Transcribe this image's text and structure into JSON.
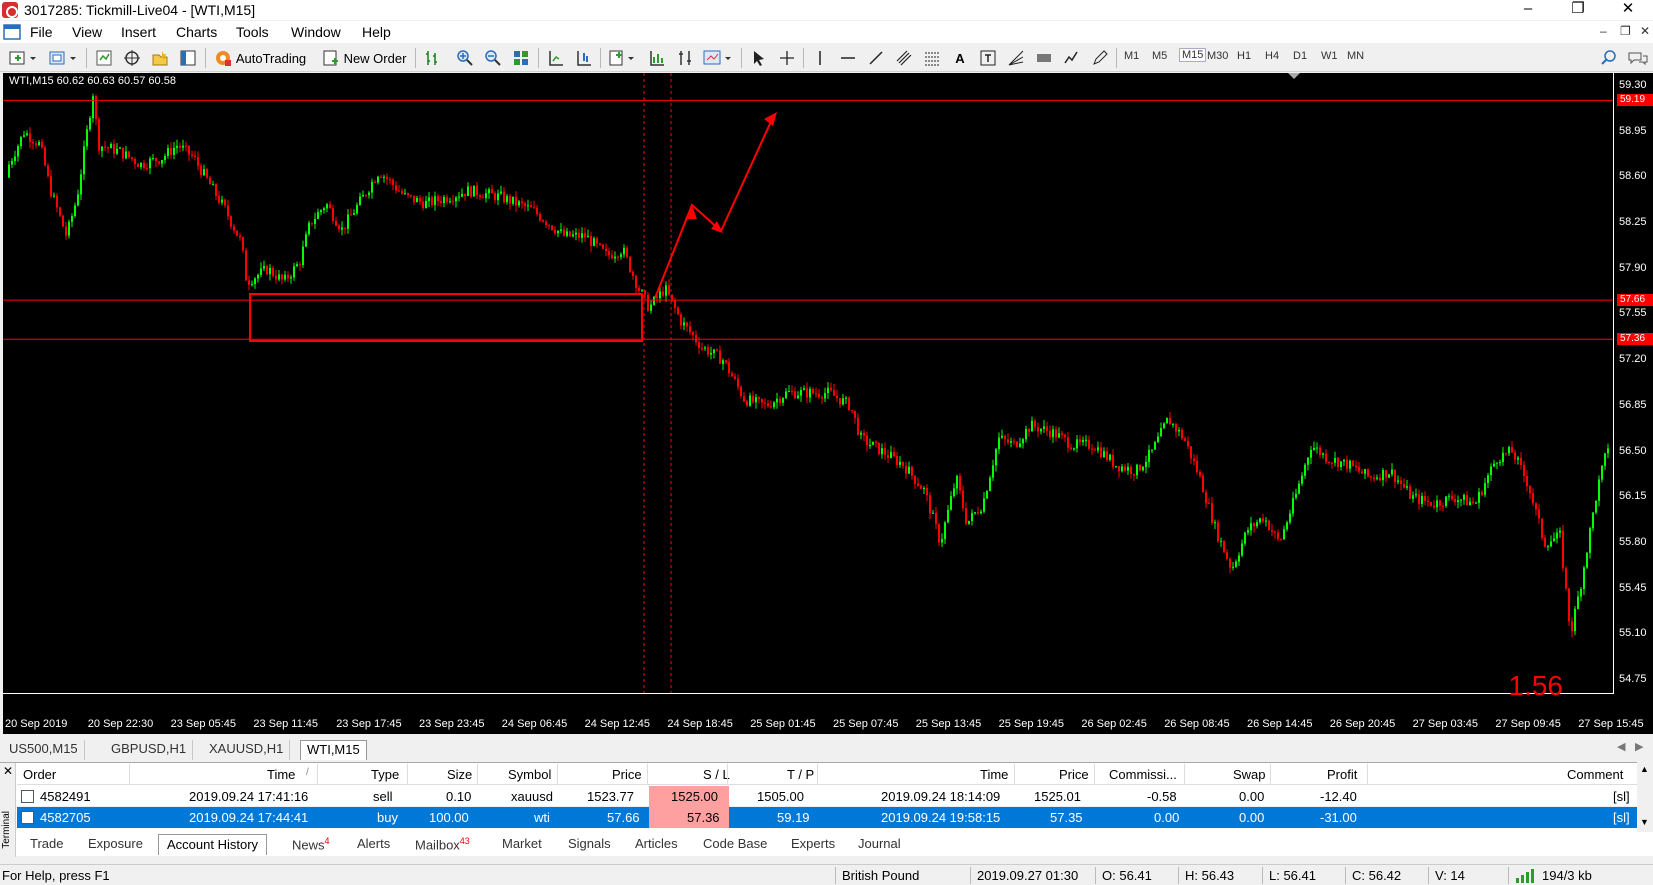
{
  "window": {
    "title": "3017285: Tickmill-Live04 - [WTI,M15]",
    "minimize_glyph": "–",
    "restore_glyph": "❐",
    "close_glyph": "✕"
  },
  "menu": {
    "items": [
      "File",
      "View",
      "Insert",
      "Charts",
      "Tools",
      "Window",
      "Help"
    ],
    "mdi_minimize": "–",
    "mdi_restore": "❐",
    "mdi_close": "✕"
  },
  "toolbar": {
    "autotrading_label": "AutoTrading",
    "new_order_label": "New Order",
    "timeframes": [
      "M1",
      "M5",
      "M15",
      "M30",
      "H1",
      "H4",
      "D1",
      "W1",
      "MN"
    ],
    "active_timeframe": "M15",
    "icons": [
      "new-chart-icon",
      "profiles-icon",
      "market-watch-icon",
      "data-window-icon",
      "navigator-icon",
      "terminal-icon",
      "bar-chart-icon",
      "zoom-in-icon",
      "zoom-out-icon",
      "tile-windows-icon",
      "chart-shift-icon",
      "autoscroll-icon",
      "indicators-icon",
      "periods-icon",
      "templates-icon",
      "cursor-icon",
      "crosshair-icon",
      "vertical-line-icon",
      "horizontal-line-icon",
      "trendline-icon",
      "equidistant-channel-icon",
      "fibonacci-icon",
      "text-icon",
      "text-label-icon",
      "arrows-icon",
      "rectangle-icon",
      "search-icon",
      "chat-icon"
    ]
  },
  "chart": {
    "header": "WTI,M15  60.62 60.63 60.57 60.58",
    "overlay_value": "1.56",
    "price_ticks": [
      "59.30",
      "58.95",
      "58.60",
      "58.25",
      "57.90",
      "57.55",
      "57.20",
      "56.85",
      "56.50",
      "56.15",
      "55.80",
      "55.45",
      "55.10",
      "54.75"
    ],
    "price_badges": [
      "59.19",
      "57.66",
      "57.36"
    ],
    "time_ticks": [
      "20 Sep 2019",
      "20 Sep 22:30",
      "23 Sep 05:45",
      "23 Sep 11:45",
      "23 Sep 17:45",
      "23 Sep 23:45",
      "24 Sep 06:45",
      "24 Sep 12:45",
      "24 Sep 18:45",
      "25 Sep 01:45",
      "25 Sep 07:45",
      "25 Sep 13:45",
      "25 Sep 19:45",
      "26 Sep 02:45",
      "26 Sep 08:45",
      "26 Sep 14:45",
      "26 Sep 20:45",
      "27 Sep 03:45",
      "27 Sep 09:45",
      "27 Sep 15:45"
    ],
    "colors": {
      "bull": "#00ff00",
      "bear": "#ff0000",
      "line": "#ff0000",
      "background": "#000000"
    }
  },
  "chart_data": {
    "type": "candlestick",
    "symbol": "WTI",
    "timeframe": "M15",
    "ylim": [
      54.65,
      59.4
    ],
    "levels": [
      59.19,
      57.66,
      57.36
    ],
    "close_path": [
      [
        0,
        58.6
      ],
      [
        0.02,
        58.95
      ],
      [
        0.035,
        58.85
      ],
      [
        0.045,
        58.5
      ],
      [
        0.06,
        58.15
      ],
      [
        0.07,
        58.45
      ],
      [
        0.085,
        59.25
      ],
      [
        0.09,
        58.85
      ],
      [
        0.11,
        58.8
      ],
      [
        0.13,
        58.7
      ],
      [
        0.15,
        58.75
      ],
      [
        0.165,
        58.85
      ],
      [
        0.18,
        58.75
      ],
      [
        0.21,
        58.35
      ],
      [
        0.225,
        58.1
      ],
      [
        0.23,
        57.8
      ],
      [
        0.25,
        57.9
      ],
      [
        0.265,
        57.8
      ],
      [
        0.28,
        57.95
      ],
      [
        0.29,
        58.25
      ],
      [
        0.305,
        58.4
      ],
      [
        0.32,
        58.2
      ],
      [
        0.34,
        58.45
      ],
      [
        0.355,
        58.65
      ],
      [
        0.38,
        58.45
      ],
      [
        0.4,
        58.4
      ],
      [
        0.42,
        58.45
      ],
      [
        0.44,
        58.5
      ],
      [
        0.47,
        58.45
      ],
      [
        0.5,
        58.35
      ],
      [
        0.53,
        58.15
      ],
      [
        0.55,
        58.15
      ],
      [
        0.57,
        58.0
      ],
      [
        0.585,
        58.05
      ],
      [
        0.6,
        57.75
      ],
      [
        0.61,
        57.6
      ],
      [
        0.625,
        57.75
      ],
      [
        0.64,
        57.5
      ],
      [
        0.66,
        57.3
      ],
      [
        0.68,
        57.2
      ],
      [
        0.7,
        56.9
      ],
      [
        0.72,
        56.85
      ],
      [
        0.74,
        56.95
      ],
      [
        0.76,
        56.95
      ],
      [
        0.78,
        56.95
      ],
      [
        0.8,
        56.85
      ],
      [
        0.81,
        56.6
      ],
      [
        0.83,
        56.5
      ],
      [
        0.85,
        56.4
      ],
      [
        0.87,
        56.2
      ],
      [
        0.885,
        55.8
      ],
      [
        0.9,
        56.3
      ],
      [
        0.91,
        55.95
      ],
      [
        0.925,
        56.1
      ],
      [
        0.94,
        56.6
      ],
      [
        0.955,
        56.55
      ],
      [
        0.97,
        56.7
      ],
      [
        0.99,
        56.65
      ],
      [
        1.01,
        56.55
      ],
      [
        1.03,
        56.55
      ],
      [
        1.05,
        56.4
      ],
      [
        1.07,
        56.35
      ],
      [
        1.085,
        56.5
      ],
      [
        1.1,
        56.75
      ],
      [
        1.115,
        56.6
      ],
      [
        1.13,
        56.3
      ],
      [
        1.145,
        55.9
      ],
      [
        1.16,
        55.6
      ],
      [
        1.175,
        55.9
      ],
      [
        1.19,
        56.0
      ],
      [
        1.205,
        55.8
      ],
      [
        1.22,
        56.15
      ],
      [
        1.235,
        56.55
      ],
      [
        1.25,
        56.45
      ],
      [
        1.27,
        56.4
      ],
      [
        1.29,
        56.3
      ],
      [
        1.31,
        56.35
      ],
      [
        1.33,
        56.15
      ],
      [
        1.35,
        56.1
      ],
      [
        1.37,
        56.15
      ],
      [
        1.39,
        56.1
      ],
      [
        1.41,
        56.45
      ],
      [
        1.425,
        56.5
      ],
      [
        1.44,
        56.25
      ],
      [
        1.455,
        55.8
      ],
      [
        1.47,
        55.85
      ],
      [
        1.48,
        55.1
      ],
      [
        1.49,
        55.5
      ],
      [
        1.505,
        56.2
      ],
      [
        1.52,
        56.7
      ]
    ],
    "series": [
      {
        "name": "",
        "note_time_start": "20 Sep 2019",
        "note_time_end": "27 Sep 15:45"
      }
    ]
  },
  "chart_tabs": [
    "US500,M15",
    "GBPUSD,H1",
    "XAUUSD,H1",
    "WTI,M15"
  ],
  "active_chart_tab": "WTI,M15",
  "terminal": {
    "side_label": "Terminal",
    "columns": [
      "Order",
      "Time",
      "Type",
      "Size",
      "Symbol",
      "Price",
      "S / L",
      "T / P",
      "Time",
      "Price",
      "Commissi...",
      "Swap",
      "Profit",
      "Comment"
    ],
    "sort_indicator": "/",
    "rows": [
      {
        "order": "4582491",
        "open_time": "2019.09.24 17:41:16",
        "type": "sell",
        "size": "0.10",
        "symbol": "xauusd",
        "price": "1523.77",
        "sl": "1525.00",
        "tp": "1505.00",
        "close_time": "2019.09.24 18:14:09",
        "close_price": "1525.01",
        "commission": "-0.58",
        "swap": "0.00",
        "profit": "-12.40",
        "comment": "[sl]"
      },
      {
        "order": "4582705",
        "open_time": "2019.09.24 17:44:41",
        "type": "buy",
        "size": "100.00",
        "symbol": "wti",
        "price": "57.66",
        "sl": "57.36",
        "tp": "59.19",
        "close_time": "2019.09.24 19:58:15",
        "close_price": "57.35",
        "commission": "0.00",
        "swap": "0.00",
        "profit": "-31.00",
        "comment": "[sl]"
      }
    ],
    "tabs": [
      {
        "label": "Trade",
        "badge": ""
      },
      {
        "label": "Exposure",
        "badge": ""
      },
      {
        "label": "Account History",
        "badge": ""
      },
      {
        "label": "News",
        "badge": "4"
      },
      {
        "label": "Alerts",
        "badge": ""
      },
      {
        "label": "Mailbox",
        "badge": "43"
      },
      {
        "label": "Market",
        "badge": ""
      },
      {
        "label": "Signals",
        "badge": ""
      },
      {
        "label": "Articles",
        "badge": ""
      },
      {
        "label": "Code Base",
        "badge": ""
      },
      {
        "label": "Experts",
        "badge": ""
      },
      {
        "label": "Journal",
        "badge": ""
      }
    ],
    "active_tab": "Account History"
  },
  "status": {
    "help": "For Help, press F1",
    "profile": "British Pound",
    "datetime": "2019.09.27 01:30",
    "open": "O: 56.41",
    "high": "H: 56.43",
    "low": "L: 56.41",
    "close": "C: 56.42",
    "volume": "V: 14",
    "traffic": "194/3 kb"
  }
}
